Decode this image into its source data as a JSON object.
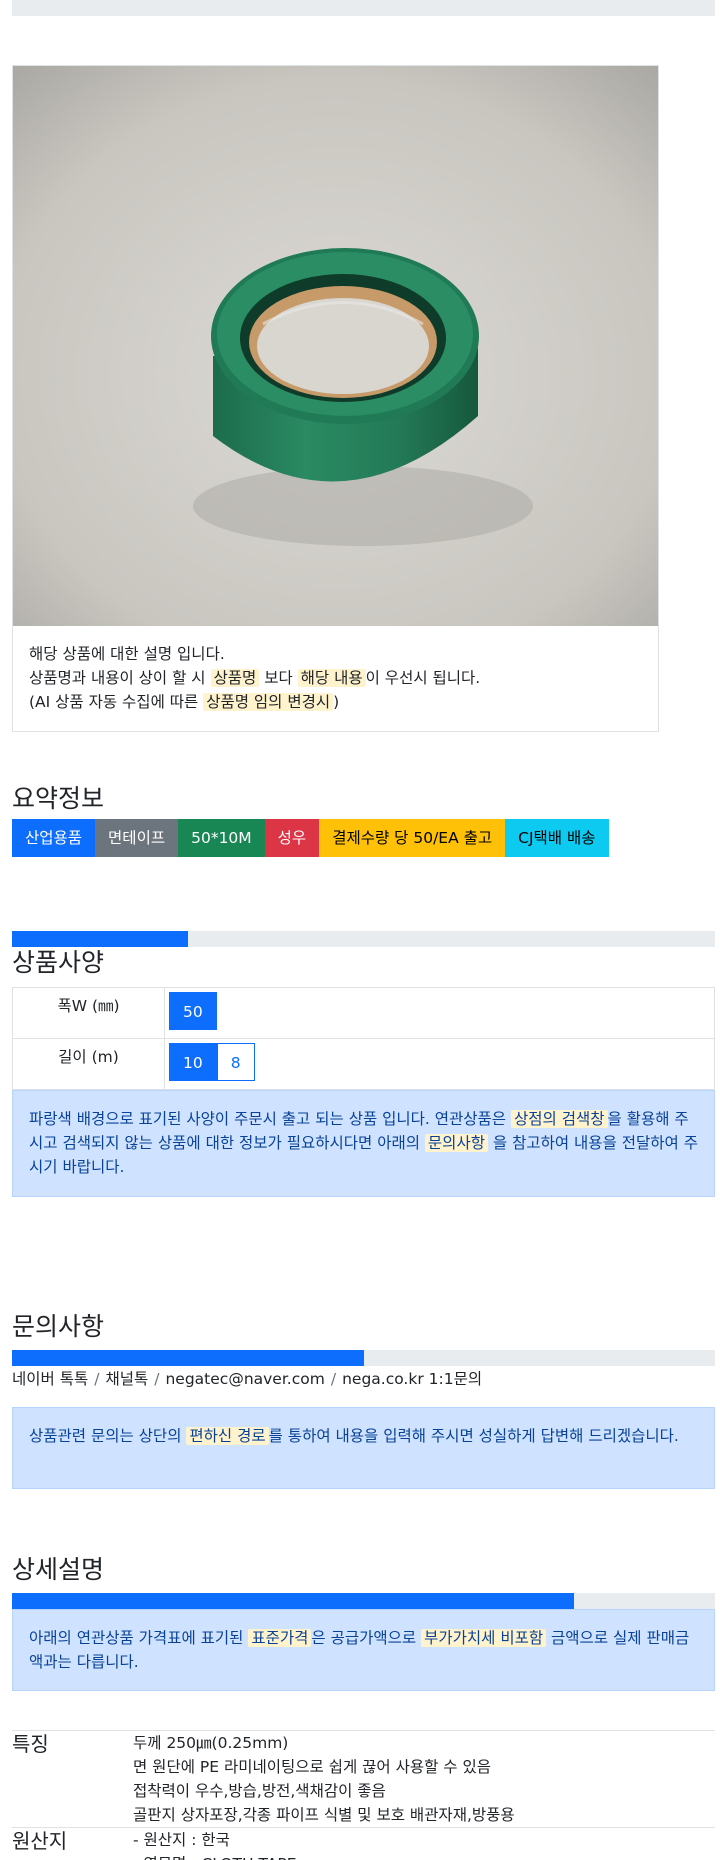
{
  "product": {
    "image_alt": "green cloth tape roll",
    "notice": {
      "line1": "해당 상품에 대한 설명 입니다.",
      "line2_pre": "상품명과 내용이 상이 할 시 ",
      "line2_hl1": "상품명",
      "line2_mid": " 보다 ",
      "line2_hl2": "해당 내용",
      "line2_post": "이 우선시 됩니다.",
      "line3_pre": "(AI 상품 자동 수집에 따른 ",
      "line3_hl": "상품명 임의 변경시",
      "line3_post": ")"
    }
  },
  "summary": {
    "title": "요약정보",
    "badges": [
      {
        "label": "산업용품",
        "color": "#0d6efd"
      },
      {
        "label": "면테이프",
        "color": "#6c757d"
      },
      {
        "label": "50*10M",
        "color": "#198754"
      },
      {
        "label": "성우",
        "color": "#dc3545"
      },
      {
        "label": "결제수량 당 50/EA 출고",
        "color": "#ffc107"
      },
      {
        "label": "CJ택배 배송",
        "color": "#0dcaf0"
      }
    ]
  },
  "specs": {
    "title": "상품사양",
    "progress": 0.25,
    "rows": [
      {
        "label": "폭W (㎜)",
        "options": [
          {
            "value": "50",
            "selected": true
          }
        ]
      },
      {
        "label": "길이 (m)",
        "options": [
          {
            "value": "10",
            "selected": true
          },
          {
            "value": "8",
            "selected": false
          }
        ]
      }
    ],
    "alert": {
      "pre": "파랑색 배경으로 표기된 사양이 주문시 출고 되는 상품 입니다. 연관상품은 ",
      "hl1": "상점의 검색창",
      "mid": "을 활용해 주시고 검색되지 않는 상품에 대한 정보가 필요하시다면 아래의 ",
      "hl2": "문의사항",
      "post": " 을 참고하여 내용을 전달하여 주시기 바랍니다."
    }
  },
  "inquiry": {
    "title": "문의사항",
    "progress": 0.5,
    "links": [
      "네이버 톡톡",
      "채널톡",
      "negatec@naver.com",
      "nega.co.kr 1:1문의"
    ],
    "alert": {
      "pre": "상품관련 문의는 상단의 ",
      "hl": "편하신 경로",
      "post": "를 통하여 내용을 입력해 주시면 성실하게 답변해 드리겠습니다."
    }
  },
  "detail": {
    "title": "상세설명",
    "progress": 0.8,
    "alert": {
      "pre": "아래의 연관상품 가격표에 표기된 ",
      "hl1": "표준가격",
      "mid": "은 공급가액으로 ",
      "hl2": "부가가치세 비포함",
      "post": " 금액으로 실제 판매금액과는 다릅니다."
    },
    "features": {
      "label": "특징",
      "lines": [
        "두께 250㎛(0.25mm)",
        "면 원단에 PE 라미네이팅으로 쉽게 끊어 사용할 수 있음",
        "접착력이 우수,방습,방전,색채감이 좋음",
        "골판지 상자포장,각종 파이프 식별 및 보호 배관자재,방풍용"
      ]
    },
    "origin": {
      "label": "원산지",
      "lines": [
        "- 원산지 : 한국",
        "- 영문명 : CLOTH TAPE"
      ]
    }
  }
}
